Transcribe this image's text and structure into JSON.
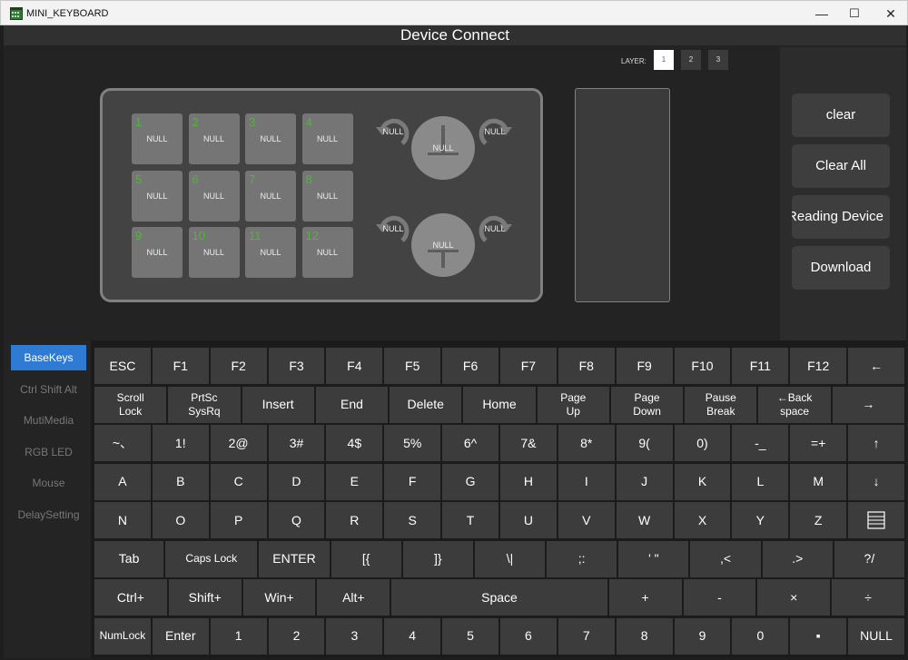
{
  "window": {
    "title": "MINI_KEYBOARD",
    "minimize": "—",
    "maximize": "☐",
    "close": "✕"
  },
  "header": {
    "title": "Device Connect"
  },
  "layers": {
    "label": "LAYER:",
    "items": [
      "1",
      "2",
      "3"
    ],
    "active": "1"
  },
  "device": {
    "keys": [
      {
        "num": "1",
        "label": "NULL"
      },
      {
        "num": "2",
        "label": "NULL"
      },
      {
        "num": "3",
        "label": "NULL"
      },
      {
        "num": "4",
        "label": "NULL"
      },
      {
        "num": "5",
        "label": "NULL"
      },
      {
        "num": "6",
        "label": "NULL"
      },
      {
        "num": "7",
        "label": "NULL"
      },
      {
        "num": "8",
        "label": "NULL"
      },
      {
        "num": "9",
        "label": "NULL"
      },
      {
        "num": "10",
        "label": "NULL"
      },
      {
        "num": "11",
        "label": "NULL"
      },
      {
        "num": "12",
        "label": "NULL"
      }
    ],
    "knobs": [
      {
        "left": "NULL",
        "press": "NULL",
        "right": "NULL"
      },
      {
        "left": "NULL",
        "press": "NULL",
        "right": "NULL"
      }
    ]
  },
  "actions": [
    "clear",
    "Clear All",
    "Reading Device",
    "Download"
  ],
  "categories": {
    "items": [
      "BaseKeys",
      "Ctrl Shift Alt",
      "MutiMedia",
      "RGB LED",
      "Mouse",
      "DelaySetting"
    ],
    "active": "BaseKeys"
  },
  "keyboard": {
    "rows": [
      [
        "ESC",
        "F1",
        "F2",
        "F3",
        "F4",
        "F5",
        "F6",
        "F7",
        "F8",
        "F9",
        "F10",
        "F11",
        "F12",
        "←"
      ],
      [
        "Scroll\nLock",
        "PrtSc\nSysRq",
        "Insert",
        "End",
        "Delete",
        "Home",
        "Page\nUp",
        "Page\nDown",
        "Pause\nBreak",
        "←Back\nspace",
        "→"
      ],
      [
        "~、",
        "1!",
        "2@",
        "3#",
        "4$",
        "5%",
        "6^",
        "7&",
        "8*",
        "9(",
        "0)",
        "-_",
        "=+",
        "↑"
      ],
      [
        "A",
        "B",
        "C",
        "D",
        "E",
        "F",
        "G",
        "H",
        "I",
        "J",
        "K",
        "L",
        "M",
        "↓"
      ],
      [
        "N",
        "O",
        "P",
        "Q",
        "R",
        "S",
        "T",
        "U",
        "V",
        "W",
        "X",
        "Y",
        "Z",
        "menu-icon"
      ],
      [
        "Tab",
        "Caps Lock",
        "ENTER",
        "[{",
        "]}",
        "\\|",
        ";:",
        "' \"",
        ",<",
        ".>",
        "?/"
      ],
      [
        "Ctrl+",
        "Shift+",
        "Win+",
        "Alt+",
        "Space",
        "+",
        "-",
        "×",
        "÷"
      ],
      [
        "NumLock",
        "Enter",
        "1",
        "2",
        "3",
        "4",
        "5",
        "6",
        "7",
        "8",
        "9",
        "0",
        "▪",
        "NULL"
      ]
    ]
  }
}
